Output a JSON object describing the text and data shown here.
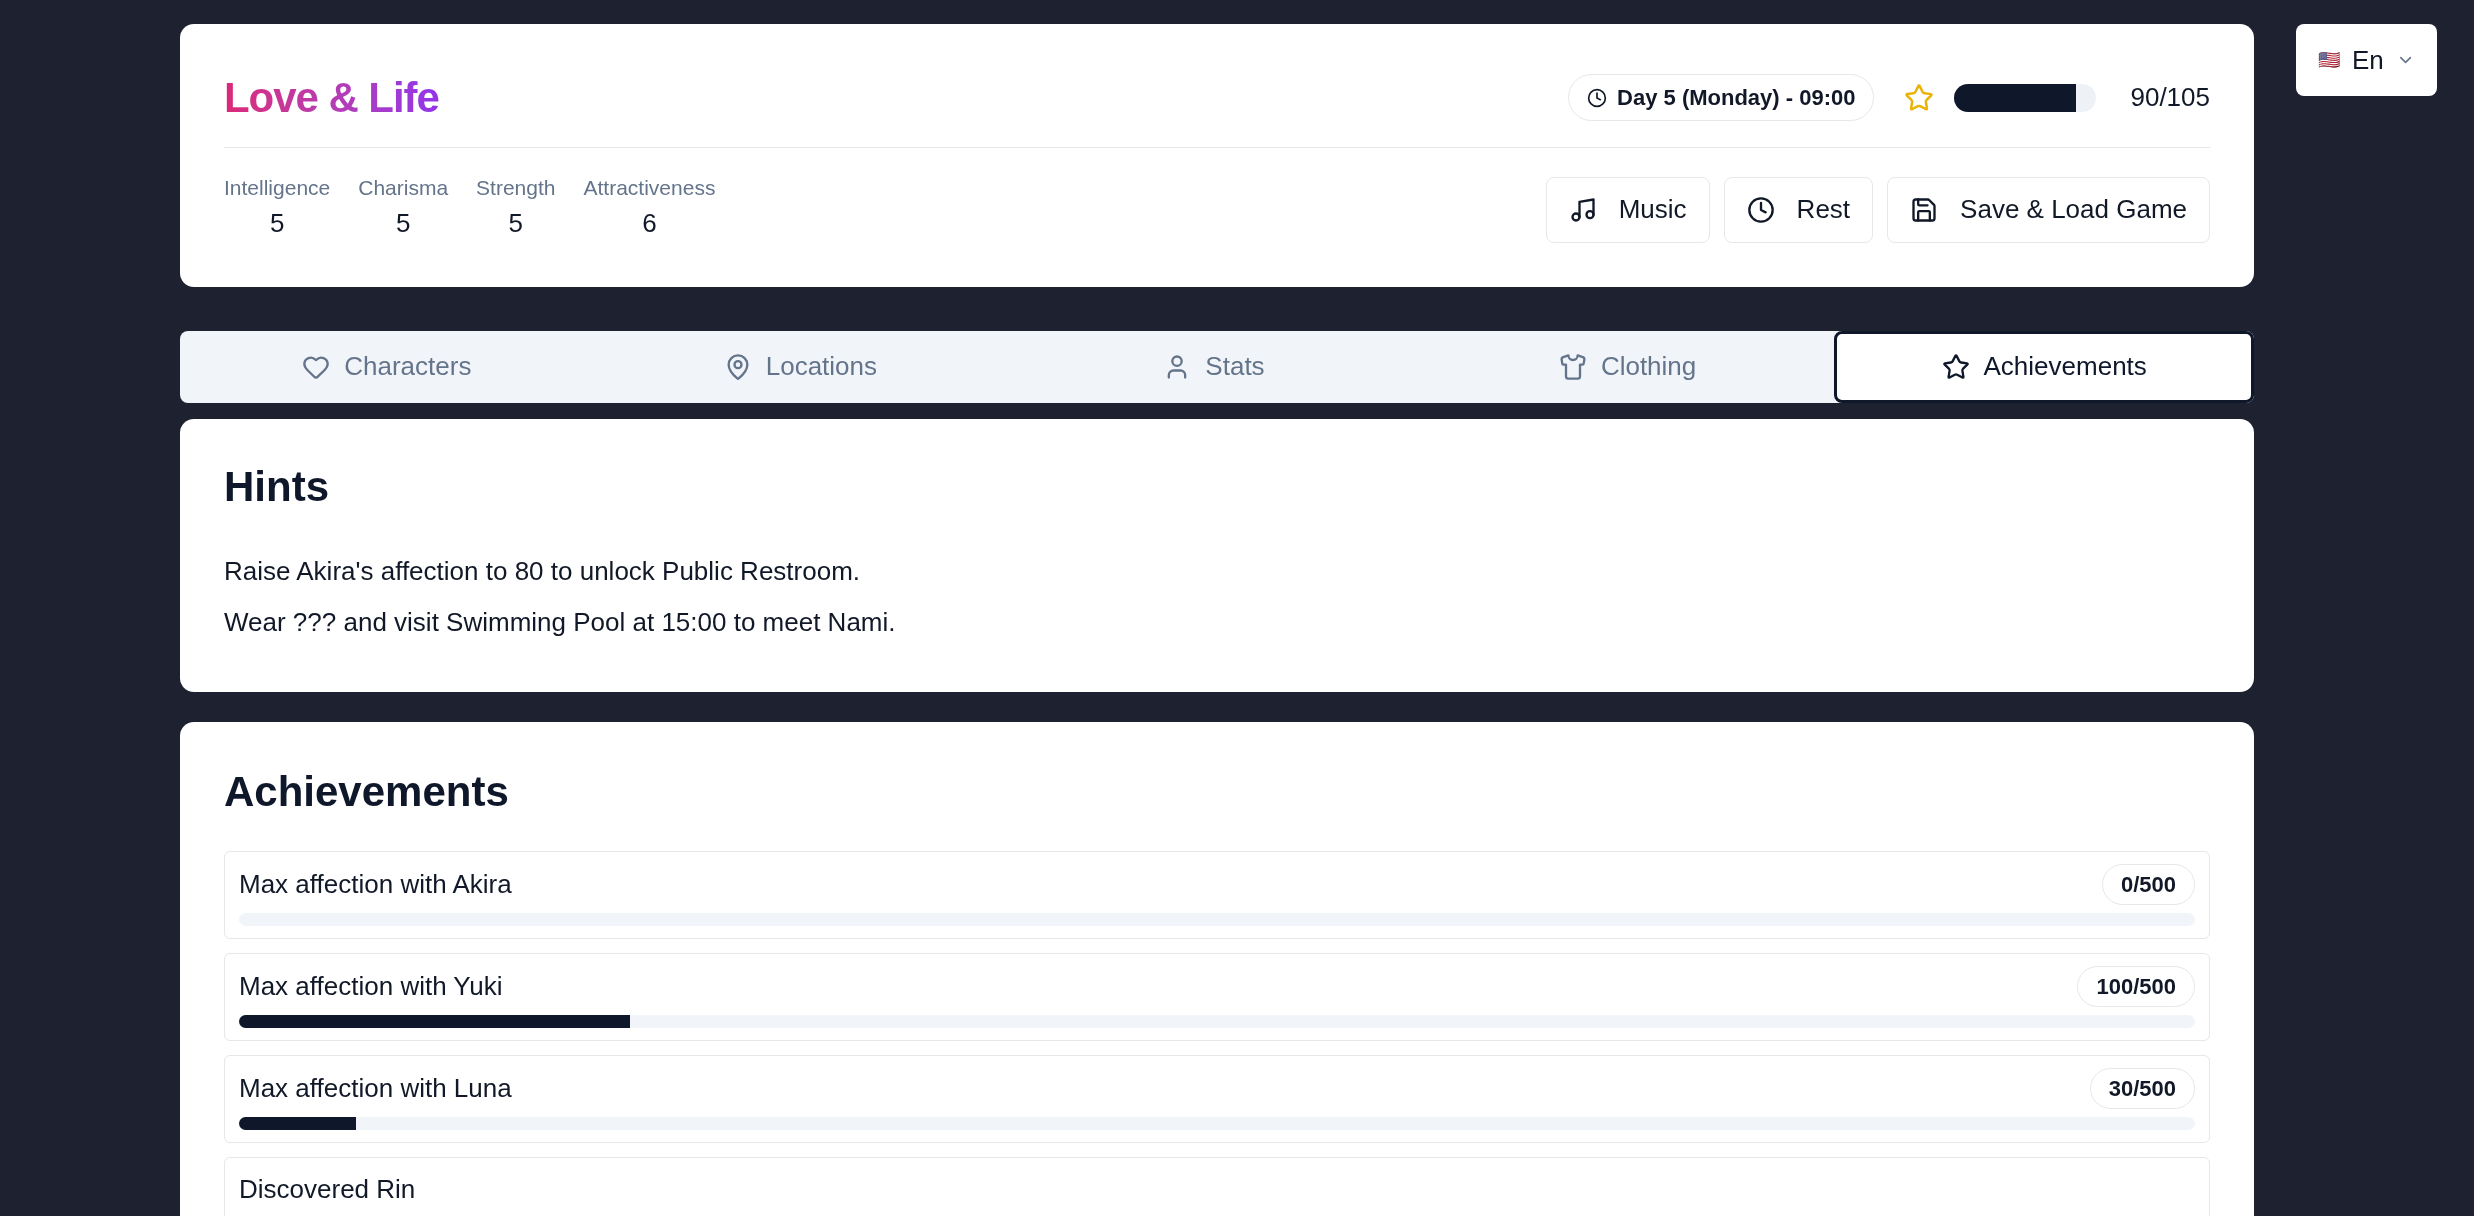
{
  "header": {
    "title": "Love & Life",
    "clock": "Day 5 (Monday) - 09:00",
    "energy": {
      "level": 0.857,
      "reading": "90/105"
    },
    "stats": [
      {
        "label": "Intelligence",
        "value": "5"
      },
      {
        "label": "Charisma",
        "value": "5"
      },
      {
        "label": "Strength",
        "value": "5"
      },
      {
        "label": "Attractiveness",
        "value": "6"
      }
    ],
    "buttons": [
      {
        "label": "Music"
      },
      {
        "label": "Rest"
      },
      {
        "label": "Save & Load Game"
      }
    ]
  },
  "language": {
    "flag": "🇺🇸",
    "label": "En"
  },
  "tabs": [
    {
      "label": "Characters",
      "selected": false
    },
    {
      "label": "Locations",
      "selected": false
    },
    {
      "label": "Stats",
      "selected": false
    },
    {
      "label": "Clothing",
      "selected": false
    },
    {
      "label": "Achievements",
      "selected": true
    }
  ],
  "hints": {
    "title": "Hints",
    "items": [
      "Raise Akira's affection to 80 to unlock Public Restroom.",
      "Wear ??? and visit Swimming Pool at 15:00 to meet Nami."
    ]
  },
  "achievements": {
    "title": "Achievements",
    "items": [
      {
        "kind": "progress",
        "name": "Max affection with Akira",
        "count": "0/500"
      },
      {
        "kind": "progress",
        "name": "Max affection with Yuki",
        "count": "100/500",
        "level": 0.2
      },
      {
        "kind": "progress",
        "name": "Max affection with Luna",
        "count": "30/500",
        "level": 0.06
      },
      {
        "kind": "milestone",
        "name": "Discovered Rin"
      }
    ]
  }
}
